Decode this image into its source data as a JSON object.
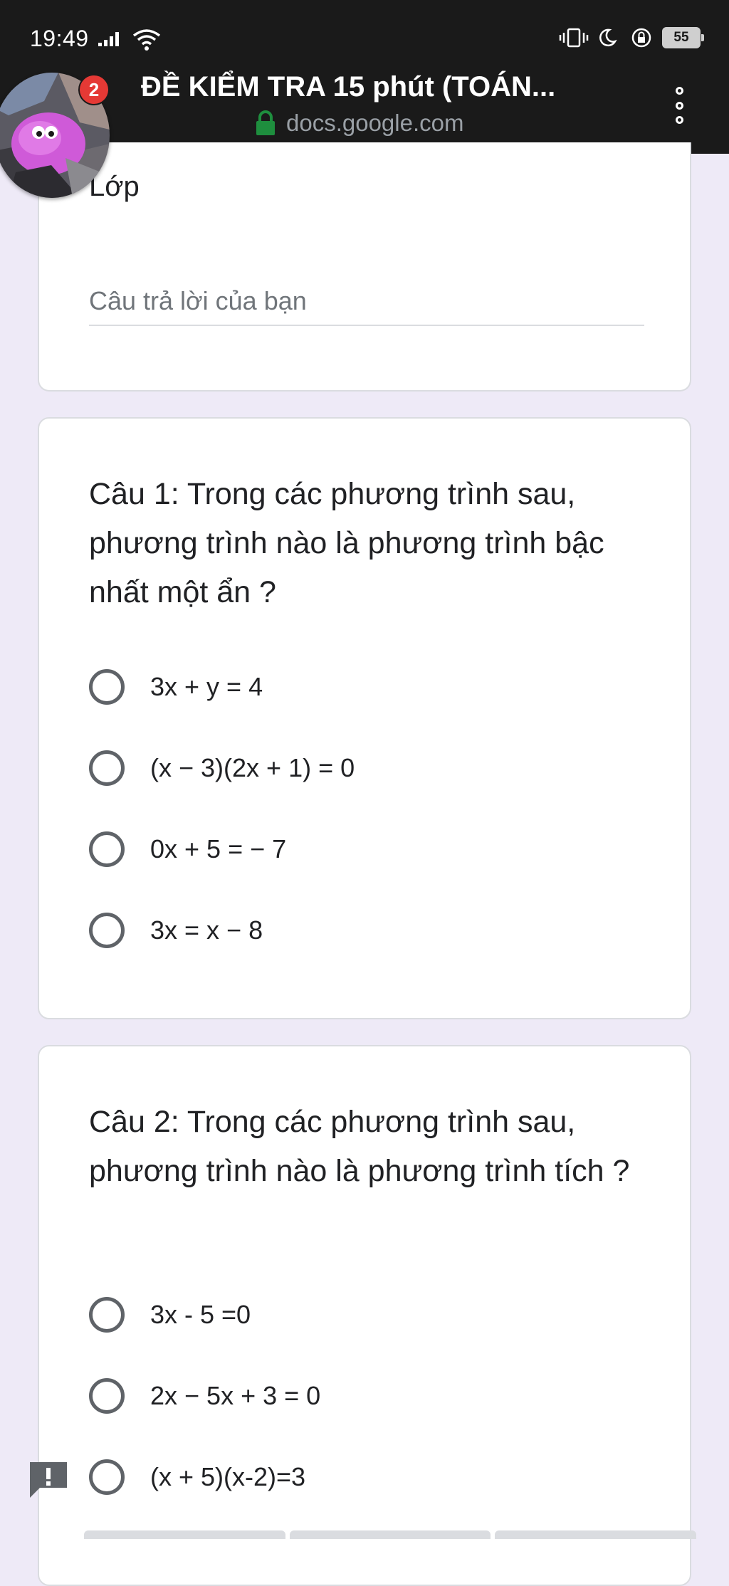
{
  "status_bar": {
    "time": "19:49",
    "battery": "55",
    "icons": [
      "signal-icon",
      "wifi-icon",
      "vibrate-icon",
      "moon-icon",
      "data-saver-icon",
      "battery-icon"
    ]
  },
  "browser": {
    "title": "ĐỀ KIỂM TRA 15 phút (TOÁN...",
    "url": "docs.google.com",
    "icons": [
      "lock-icon",
      "menu-dots-icon"
    ]
  },
  "chat_head": {
    "badge_count": "2"
  },
  "form": {
    "class_field": {
      "label": "Lớp",
      "placeholder": "Câu trả lời của bạn"
    },
    "questions": [
      {
        "text": "Câu 1: Trong các phương trình sau, phương trình nào là phương trình bậc nhất một ẩn ?",
        "options": [
          "3x + y = 4",
          "(x − 3)(2x + 1) = 0",
          "0x + 5 = − 7",
          "3x = x − 8"
        ]
      },
      {
        "text": "Câu 2: Trong các phương trình sau, phương trình nào là phương trình tích ?",
        "options": [
          "3x - 5 =0",
          "2x − 5x + 3 = 0",
          "(x + 5)(x-2)=3"
        ]
      }
    ]
  },
  "colors": {
    "background": "#eeeaf7",
    "header": "#1a1a1a",
    "lock": "#1e8e3e",
    "badge": "#e53935",
    "radio": "#5f6368"
  }
}
